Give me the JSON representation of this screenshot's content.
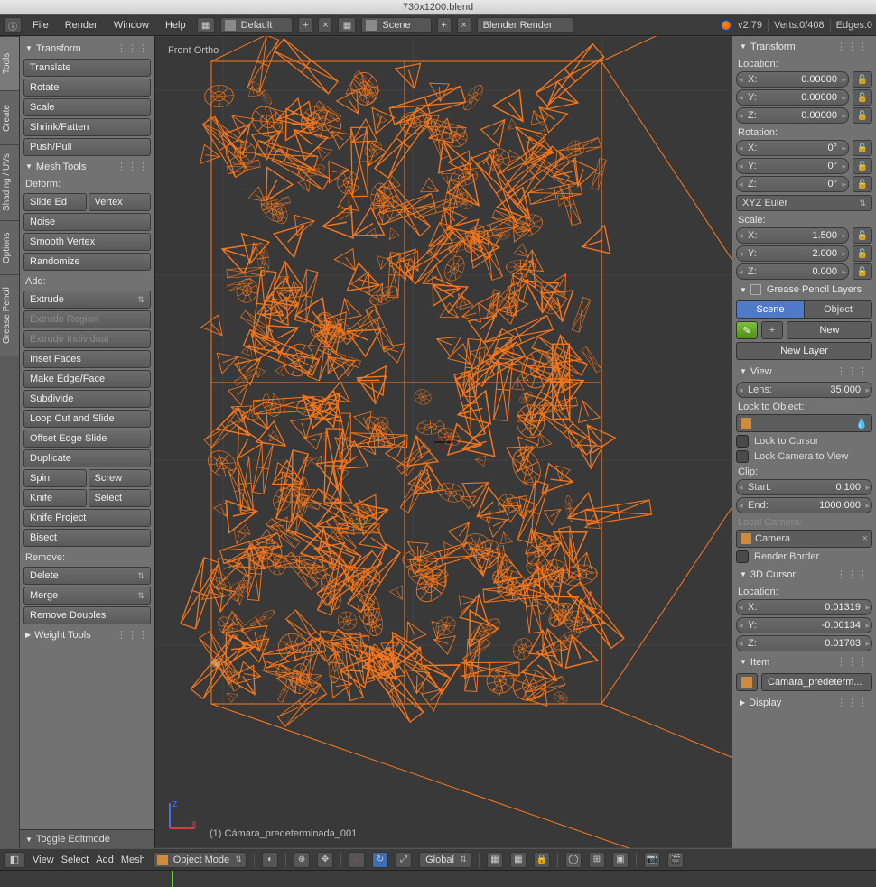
{
  "titlebar": {
    "filename": "730x1200.blend"
  },
  "topbar": {
    "menus": [
      "File",
      "Render",
      "Window",
      "Help"
    ],
    "layout": "Default",
    "scene": "Scene",
    "engine": "Blender Render",
    "version": "v2.79",
    "stats": "Verts:0/408",
    "stats_edges": "Edges:0"
  },
  "left_tabs": [
    "Tools",
    "Create",
    "Shading / UVs",
    "Options",
    "Grease Pencil"
  ],
  "toolshelf": {
    "transform": {
      "title": "Transform",
      "items": [
        "Translate",
        "Rotate",
        "Scale",
        "Shrink/Fatten",
        "Push/Pull"
      ]
    },
    "meshtools": {
      "title": "Mesh Tools",
      "deform_label": "Deform:",
      "deform": {
        "slide_edge": "Slide Ed",
        "vertex": "Vertex",
        "noise": "Noise",
        "smooth": "Smooth Vertex",
        "randomize": "Randomize"
      },
      "add_label": "Add:",
      "add": {
        "extrude": "Extrude",
        "extrude_region": "Extrude Region",
        "extrude_individual": "Extrude Individual",
        "inset": "Inset Faces",
        "make_edgeface": "Make Edge/Face",
        "subdivide": "Subdivide",
        "loopcut": "Loop Cut and Slide",
        "offset_edge": "Offset Edge Slide",
        "duplicate": "Duplicate",
        "spin": "Spin",
        "screw": "Screw",
        "knife": "Knife",
        "select": "Select",
        "knife_project": "Knife Project",
        "bisect": "Bisect"
      },
      "remove_label": "Remove:",
      "remove": {
        "delete": "Delete",
        "merge": "Merge",
        "remove_doubles": "Remove Doubles"
      }
    },
    "weight": {
      "title": "Weight Tools"
    },
    "toggle_editmode": "Toggle Editmode"
  },
  "viewport": {
    "view_label": "Front Ortho",
    "object_label": "(1) Cámara_predeterminada_001"
  },
  "rpanel": {
    "transform": {
      "title": "Transform",
      "location_label": "Location:",
      "loc": {
        "x": "0.00000",
        "y": "0.00000",
        "z": "0.00000"
      },
      "rotation_label": "Rotation:",
      "rot": {
        "x": "0°",
        "y": "0°",
        "z": "0°"
      },
      "rotmode": "XYZ Euler",
      "scale_label": "Scale:",
      "scale": {
        "x": "1.500",
        "y": "2.000",
        "z": "0.000"
      }
    },
    "grease": {
      "title": "Grease Pencil Layers",
      "tab_scene": "Scene",
      "tab_object": "Object",
      "new": "New",
      "new_layer": "New Layer"
    },
    "view": {
      "title": "View",
      "lens_label": "Lens:",
      "lens": "35.000",
      "lock_label": "Lock to Object:",
      "lock_cursor": "Lock to Cursor",
      "lock_cam": "Lock Camera to View",
      "clip_label": "Clip:",
      "clip_start_label": "Start:",
      "clip_start": "0.100",
      "clip_end_label": "End:",
      "clip_end": "1000.000",
      "local_cam_label": "Local Camera:",
      "camera_name": "Camera",
      "render_border": "Render Border"
    },
    "cursor3d": {
      "title": "3D Cursor",
      "location_label": "Location:",
      "x": "0.01319",
      "y": "-0.00134",
      "z": "0.01703"
    },
    "item": {
      "title": "Item",
      "name": "Cámara_predeterm..."
    },
    "display": {
      "title": "Display"
    }
  },
  "viewheader": {
    "menus": [
      "View",
      "Select",
      "Add",
      "Mesh"
    ],
    "mode": "Object Mode",
    "orientation": "Global"
  }
}
